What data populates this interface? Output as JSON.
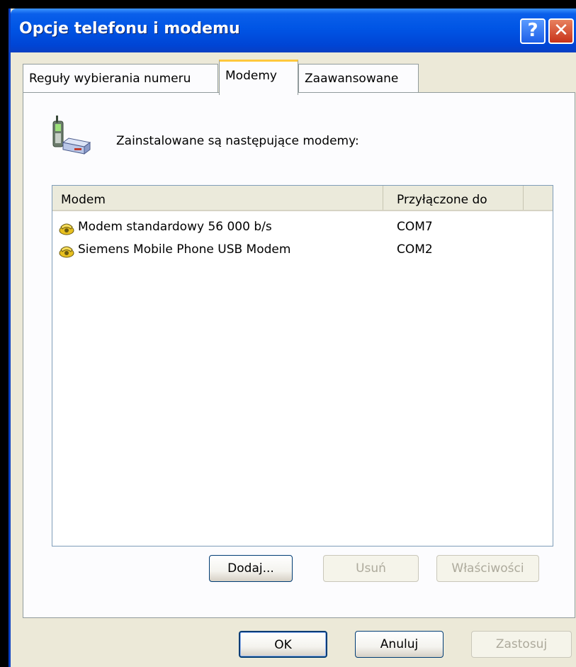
{
  "window": {
    "title": "Opcje telefonu i modemu",
    "help_glyph": "?",
    "close_glyph": "✕"
  },
  "tabs": [
    {
      "label": "Reguły wybierania numeru",
      "active": false
    },
    {
      "label": "Modemy",
      "active": true
    },
    {
      "label": "Zaawansowane",
      "active": false
    }
  ],
  "modems_tab": {
    "intro": "Zainstalowane są następujące modemy:",
    "columns": [
      "Modem",
      "Przyłączone do"
    ],
    "rows": [
      {
        "name": "Modem standardowy 56 000 b/s",
        "port": "COM7"
      },
      {
        "name": "Siemens Mobile Phone USB Modem",
        "port": "COM2"
      }
    ],
    "buttons": {
      "add": "Dodaj...",
      "remove": "Usuń",
      "properties": "Właściwości"
    }
  },
  "footer": {
    "ok": "OK",
    "cancel": "Anuluj",
    "apply": "Zastosuj"
  },
  "colors": {
    "titlebar": "#0055E5",
    "face": "#ECE9D8",
    "active_tab_accent": "#FFC83C"
  }
}
